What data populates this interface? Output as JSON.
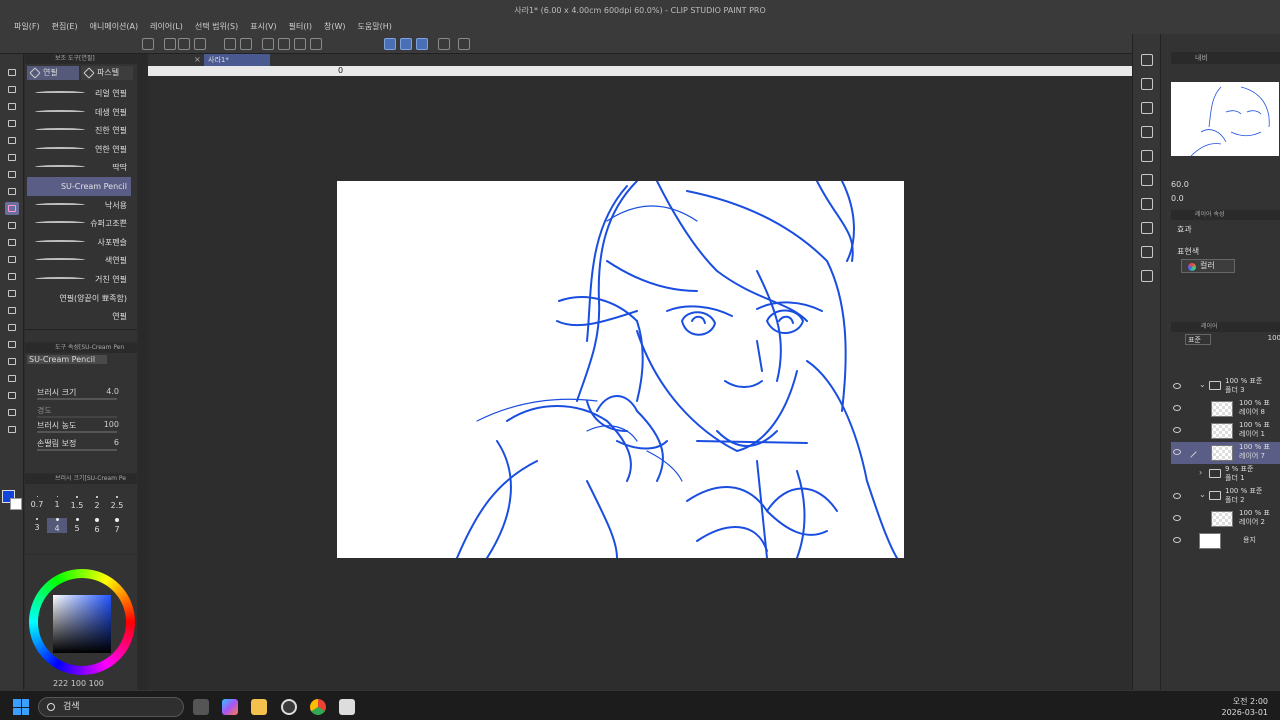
{
  "window": {
    "title": "사라1* (6.00 x 4.00cm 600dpi 60.0%)  - CLIP STUDIO PAINT PRO"
  },
  "menu": [
    "파일(F)",
    "편집(E)",
    "애니메이션(A)",
    "레이어(L)",
    "선택 범위(S)",
    "표시(V)",
    "필터(I)",
    "창(W)",
    "도움말(H)"
  ],
  "subtool": {
    "header": "보조 도구[연필]",
    "tabs": [
      "연필",
      "파스텔"
    ],
    "active_tab": "연필",
    "brushes": [
      "리얼 연필",
      "데생 연필",
      "진한 연필",
      "연한 연필",
      "딱딱",
      "SU-Cream Pencil",
      "낙서용",
      "슈퍼고조쁜",
      "사포펜슬",
      "색연필",
      "거친 연필",
      "연필(양끝이 뾰족함)",
      "연필"
    ],
    "selected_brush": "SU-Cream Pencil"
  },
  "tool_property": {
    "header": "도구 속성[SU-Cream Pen",
    "name": "SU-Cream Pencil",
    "rows": [
      {
        "label": "브러시 크기",
        "value": "4.0"
      },
      {
        "label": "경도",
        "value": ""
      },
      {
        "label": "브러시 농도",
        "value": "100"
      },
      {
        "label": "손떨림 보정",
        "value": "6"
      }
    ]
  },
  "brush_size": {
    "header": "브러시 크기[SU-Cream Pe",
    "sizes": [
      "0.7",
      "1",
      "1.5",
      "2",
      "2.5",
      "3",
      "4",
      "5",
      "6",
      "7"
    ],
    "selected": "4"
  },
  "color": {
    "main": "#1144dd",
    "sub": "#ffffff",
    "values": "222 100 100"
  },
  "document": {
    "tab": "사라1*",
    "ruler_zero": "0"
  },
  "navigator": {
    "header": "내비",
    "zoom": "60.0",
    "rotate": "0.0"
  },
  "layer_property": {
    "header": "레이어 속성",
    "effect": "효과",
    "expression_color": "표현색",
    "color_button": "컬러"
  },
  "layers": {
    "header": "레이어",
    "blend": "표준",
    "opacity": "100",
    "items": [
      {
        "name": "100 % 표준\n폴더 3",
        "type": "folder",
        "indent": 1
      },
      {
        "name": "100 % 표\n레이어 8",
        "type": "layer",
        "indent": 2
      },
      {
        "name": "100 % 표\n레이어 1",
        "type": "layer",
        "indent": 2
      },
      {
        "name": "100 % 표\n레이어 7",
        "type": "layer",
        "indent": 2,
        "selected": true
      },
      {
        "name": "9 % 표준\n폴더 1",
        "type": "folder",
        "indent": 1
      },
      {
        "name": "100 % 표준\n폴더 2",
        "type": "folder",
        "indent": 1
      },
      {
        "name": "100 % 표\n레이어 2",
        "type": "layer",
        "indent": 2
      },
      {
        "name": "용지",
        "type": "paper",
        "indent": 1
      }
    ]
  },
  "taskbar": {
    "search_placeholder": "검색",
    "time": "오전 2:00",
    "date": "2026-03-01"
  }
}
